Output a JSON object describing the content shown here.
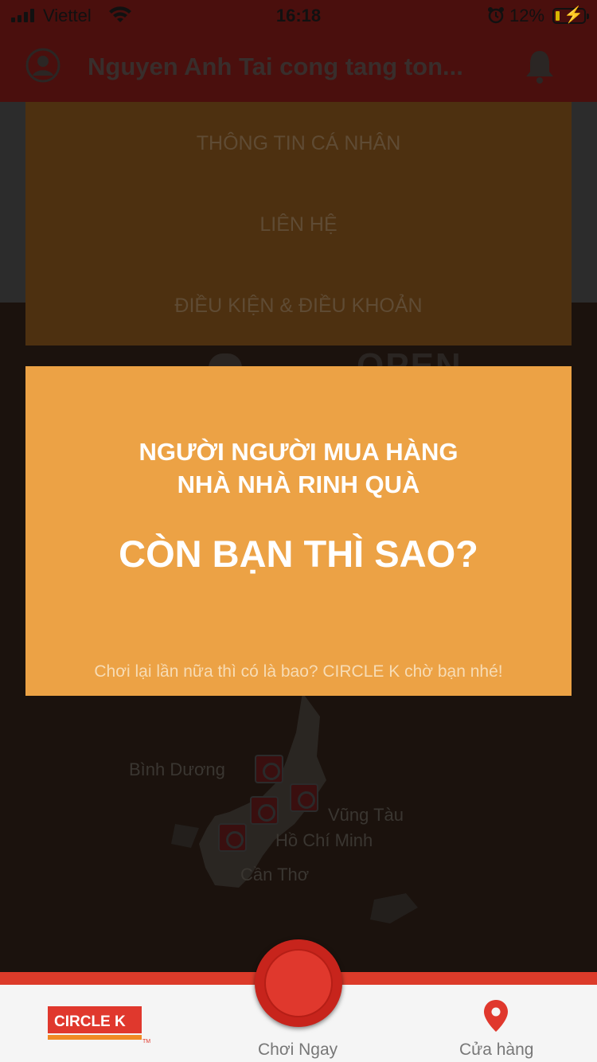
{
  "status_bar": {
    "carrier": "Viettel",
    "time": "16:18",
    "battery_percent": "12%",
    "icons": [
      "signal-icon",
      "wifi-icon",
      "alarm-icon",
      "battery-charging-icon"
    ]
  },
  "header": {
    "title": "Nguyen Anh Tai cong tang ton...",
    "icons": [
      "user-avatar-icon",
      "bell-icon"
    ]
  },
  "background": {
    "open_text": "OPEN",
    "map_labels": [
      "Bình Dương",
      "Vũng Tàu",
      "Hồ Chí Minh",
      "Cần Thơ"
    ]
  },
  "menu": {
    "items": [
      "THÔNG TIN CÁ NHÂN",
      "LIÊN HỆ",
      "ĐIỀU KIỆN & ĐIỀU KHOẢN"
    ]
  },
  "promo": {
    "line1": "NGƯỜI NGƯỜI MUA HÀNG",
    "line2": "NHÀ NHÀ RINH QUÀ",
    "headline": "CÒN BẠN THÌ SAO?",
    "footer": "Chơi lại lần nữa thì có là bao? CIRCLE K chờ bạn nhé!"
  },
  "tab_bar": {
    "logo_text": "CIRCLE K",
    "logo_tm": "TM",
    "play_label": "Chơi Ngay",
    "store_label": "Cửa hàng",
    "icons": [
      "circle-k-logo",
      "play-button",
      "map-pin-icon"
    ]
  },
  "colors": {
    "brand_red": "#e0382d",
    "header_dark_red": "#4a0f0d",
    "promo_orange": "#eca245",
    "menu_brown": "#4d3010"
  }
}
